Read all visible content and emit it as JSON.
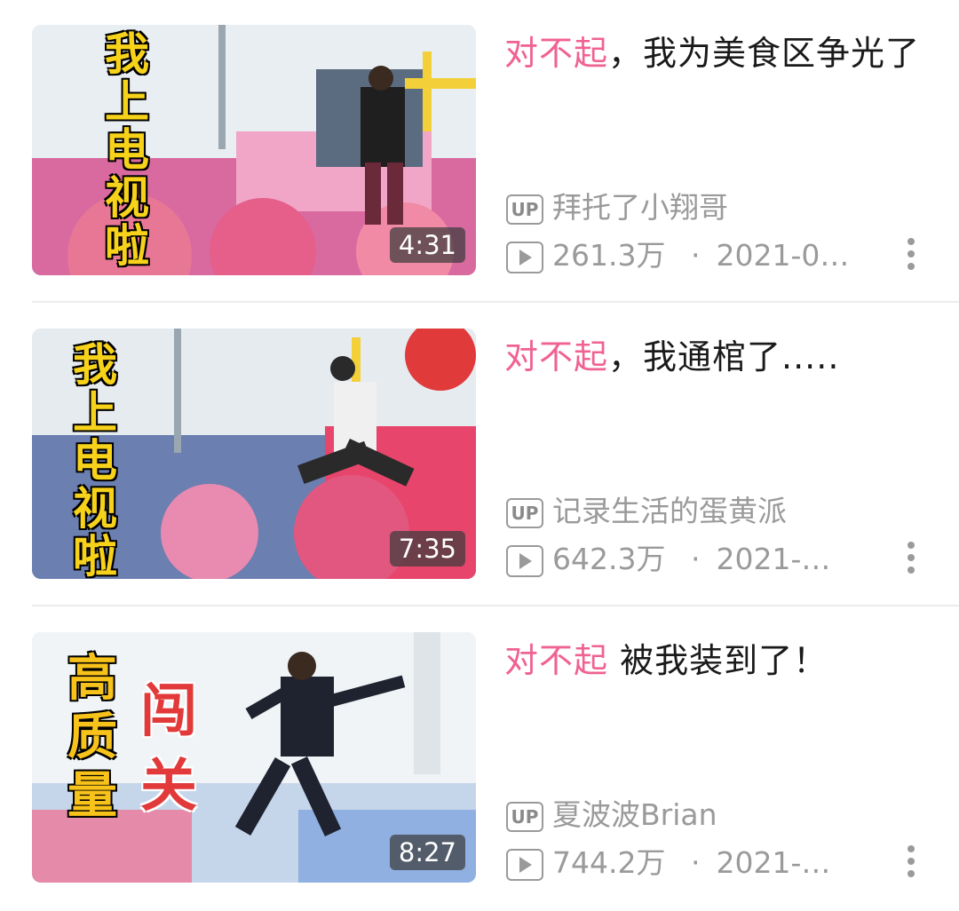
{
  "videos": [
    {
      "thumb_text": "我上电视啦",
      "duration": "4:31",
      "title_highlight": "对不起",
      "title_rest": "，我为美食区争光了",
      "uploader": "拜托了小翔哥",
      "views": "261.3万",
      "date": "2021-0…"
    },
    {
      "thumb_text": "我上电视啦",
      "duration": "7:35",
      "title_highlight": "对不起",
      "title_rest": "，我通棺了.....",
      "uploader": "记录生活的蛋黄派",
      "views": "642.3万",
      "date": "2021-…"
    },
    {
      "thumb_text_left": "高质量",
      "thumb_text_right": "闯关",
      "duration": "8:27",
      "title_highlight": "对不起",
      "title_rest": " 被我装到了！",
      "uploader": "夏波波Brian",
      "views": "744.2万",
      "date": "2021-…"
    }
  ],
  "labels": {
    "up_badge": "UP",
    "separator": "·"
  },
  "colors": {
    "highlight": "#f06292",
    "meta": "#9a9a9a",
    "thumb_text_yellow": "#f7d21a",
    "thumb_text_red": "#e23a3a"
  }
}
